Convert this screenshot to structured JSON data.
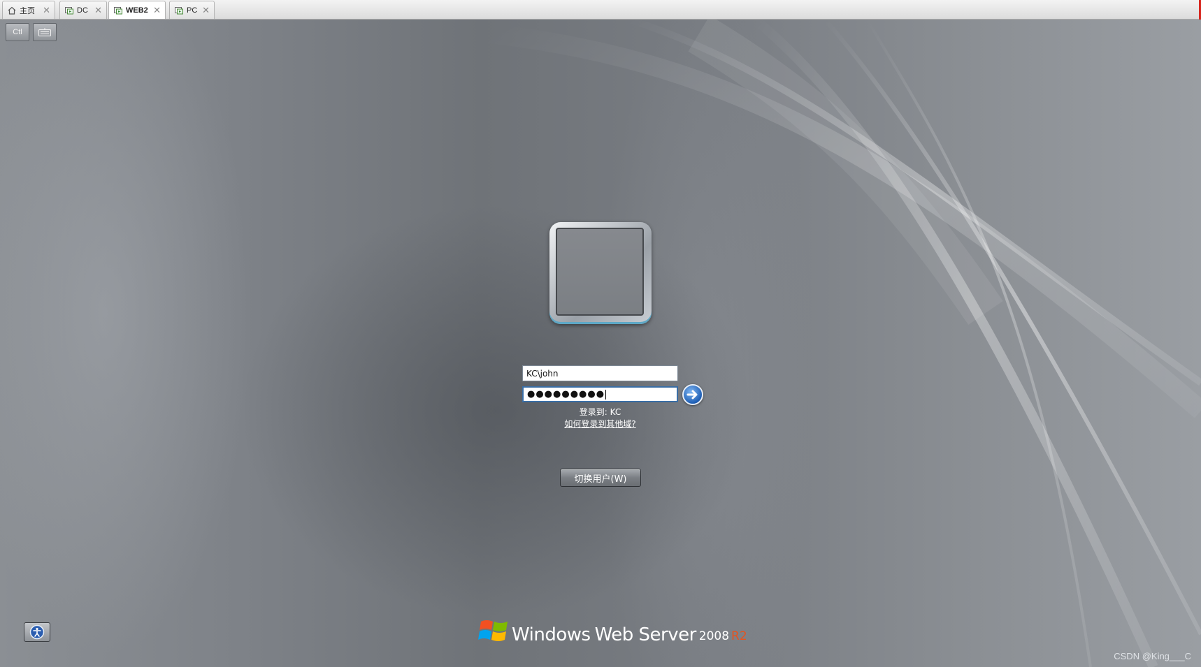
{
  "tabs": [
    {
      "label": "主页",
      "icon": "home-icon",
      "active": false
    },
    {
      "label": "DC",
      "icon": "vm-icon",
      "active": false
    },
    {
      "label": "WEB2",
      "icon": "vm-icon",
      "active": true
    },
    {
      "label": "PC",
      "icon": "vm-icon",
      "active": false
    }
  ],
  "toolbar": {
    "ctrl_alt_del_label": "Ctl",
    "keyboard_icon": "keyboard-icon"
  },
  "login": {
    "username_value": "KC\\john",
    "password_value": "●●●●●●●●●",
    "login_to": "登录到: KC",
    "other_domain_link": "如何登录到其他域?",
    "switch_user_label": "切换用户(W)",
    "submit_icon": "arrow-right-icon"
  },
  "branding": {
    "windows": "Windows",
    "product": "Web Server",
    "year": "2008",
    "edition": "R2"
  },
  "watermark": "CSDN @King___C",
  "colors": {
    "edition_accent": "#e5531f",
    "submit_blue": "#1f5fb5",
    "tab_close_marker": "#d7261e"
  }
}
